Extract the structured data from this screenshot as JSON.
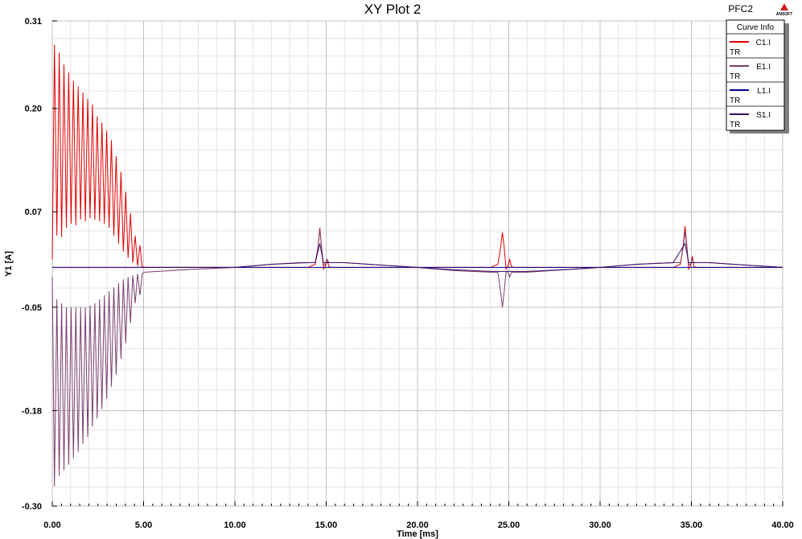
{
  "window": {
    "title": "XY Plot 2",
    "project": "PFC2",
    "logo_text": "ANSOFT"
  },
  "legend": {
    "title": "Curve Info",
    "entries": [
      {
        "name": "C1.I",
        "sub": "TR",
        "color": "#e00000"
      },
      {
        "name": "E1.I",
        "sub": "TR",
        "color": "#7a3e6e"
      },
      {
        "name": "L1.I",
        "sub": "TR",
        "color": "#000090"
      },
      {
        "name": "S1.I",
        "sub": "TR",
        "color": "#3a0a60"
      }
    ]
  },
  "chart_data": {
    "type": "line",
    "title": "XY Plot 2",
    "xlabel": "Time [ms]",
    "ylabel": "Y1 [A]",
    "xlim": [
      0,
      40
    ],
    "ylim": [
      -0.3,
      0.31
    ],
    "x_ticks": [
      "0.00",
      "5.00",
      "10.00",
      "15.00",
      "20.00",
      "25.00",
      "30.00",
      "35.00",
      "40.00"
    ],
    "y_ticks": [
      "0.31",
      "0.20",
      "0.07",
      "-0.05",
      "-0.18",
      "-0.30"
    ],
    "y_tick_values": [
      0.31,
      0.2,
      0.07,
      -0.05,
      -0.18,
      -0.3
    ],
    "grid": true,
    "legend_position": "top-right",
    "series": [
      {
        "name": "C1.I",
        "color": "#e00000",
        "points": [
          [
            0.0,
            0.01
          ],
          [
            0.12,
            0.28
          ],
          [
            0.25,
            0.04
          ],
          [
            0.38,
            0.27
          ],
          [
            0.51,
            0.038
          ],
          [
            0.64,
            0.255
          ],
          [
            0.77,
            0.05
          ],
          [
            0.9,
            0.245
          ],
          [
            1.03,
            0.055
          ],
          [
            1.16,
            0.235
          ],
          [
            1.29,
            0.053
          ],
          [
            1.42,
            0.228
          ],
          [
            1.55,
            0.06
          ],
          [
            1.68,
            0.22
          ],
          [
            1.81,
            0.058
          ],
          [
            1.94,
            0.212
          ],
          [
            2.07,
            0.062
          ],
          [
            2.2,
            0.205
          ],
          [
            2.33,
            0.06
          ],
          [
            2.46,
            0.19
          ],
          [
            2.59,
            0.058
          ],
          [
            2.72,
            0.182
          ],
          [
            2.85,
            0.055
          ],
          [
            2.98,
            0.172
          ],
          [
            3.11,
            0.05
          ],
          [
            3.24,
            0.16
          ],
          [
            3.37,
            0.04
          ],
          [
            3.5,
            0.14
          ],
          [
            3.63,
            0.03
          ],
          [
            3.76,
            0.12
          ],
          [
            3.89,
            0.02
          ],
          [
            4.02,
            0.095
          ],
          [
            4.15,
            0.012
          ],
          [
            4.28,
            0.068
          ],
          [
            4.41,
            0.006
          ],
          [
            4.54,
            0.04
          ],
          [
            4.67,
            0.002
          ],
          [
            4.8,
            0.028
          ],
          [
            4.92,
            0.001
          ],
          [
            5.05,
            0.0
          ],
          [
            6,
            0.0
          ],
          [
            8,
            0.0
          ],
          [
            10,
            0.0
          ],
          [
            12,
            0.0
          ],
          [
            14,
            0.0
          ],
          [
            14.4,
            0.004
          ],
          [
            14.55,
            0.025
          ],
          [
            14.65,
            0.05
          ],
          [
            14.75,
            0.025
          ],
          [
            14.85,
            -0.002
          ],
          [
            14.95,
            0.002
          ],
          [
            15.05,
            0.01
          ],
          [
            15.15,
            0.001
          ],
          [
            15.3,
            0.0
          ],
          [
            18,
            0.0
          ],
          [
            20,
            0.0
          ],
          [
            22,
            0.0
          ],
          [
            24,
            0.0
          ],
          [
            24.4,
            0.004
          ],
          [
            24.55,
            0.025
          ],
          [
            24.65,
            0.044
          ],
          [
            24.75,
            0.025
          ],
          [
            24.85,
            -0.002
          ],
          [
            24.95,
            0.002
          ],
          [
            25.05,
            0.01
          ],
          [
            25.15,
            0.001
          ],
          [
            25.3,
            0.0
          ],
          [
            28,
            0.0
          ],
          [
            30,
            0.0
          ],
          [
            32,
            0.0
          ],
          [
            34,
            0.0
          ],
          [
            34.4,
            0.004
          ],
          [
            34.55,
            0.028
          ],
          [
            34.65,
            0.052
          ],
          [
            34.75,
            0.028
          ],
          [
            34.85,
            -0.002
          ],
          [
            34.95,
            0.002
          ],
          [
            35.05,
            0.014
          ],
          [
            35.15,
            0.001
          ],
          [
            35.3,
            0.0
          ],
          [
            38,
            0.0
          ],
          [
            40,
            0.0
          ]
        ]
      },
      {
        "name": "E1.I",
        "color": "#7a3e6e",
        "points": [
          [
            0.0,
            -0.012
          ],
          [
            0.12,
            -0.275
          ],
          [
            0.25,
            -0.04
          ],
          [
            0.38,
            -0.262
          ],
          [
            0.51,
            -0.045
          ],
          [
            0.64,
            -0.255
          ],
          [
            0.77,
            -0.05
          ],
          [
            0.9,
            -0.248
          ],
          [
            1.03,
            -0.05
          ],
          [
            1.16,
            -0.24
          ],
          [
            1.29,
            -0.05
          ],
          [
            1.42,
            -0.232
          ],
          [
            1.55,
            -0.05
          ],
          [
            1.68,
            -0.222
          ],
          [
            1.81,
            -0.05
          ],
          [
            1.94,
            -0.213
          ],
          [
            2.07,
            -0.048
          ],
          [
            2.2,
            -0.2
          ],
          [
            2.33,
            -0.045
          ],
          [
            2.46,
            -0.19
          ],
          [
            2.59,
            -0.04
          ],
          [
            2.72,
            -0.178
          ],
          [
            2.85,
            -0.035
          ],
          [
            2.98,
            -0.165
          ],
          [
            3.11,
            -0.03
          ],
          [
            3.24,
            -0.15
          ],
          [
            3.37,
            -0.025
          ],
          [
            3.5,
            -0.135
          ],
          [
            3.63,
            -0.02
          ],
          [
            3.76,
            -0.115
          ],
          [
            3.89,
            -0.015
          ],
          [
            4.02,
            -0.095
          ],
          [
            4.15,
            -0.012
          ],
          [
            4.28,
            -0.07
          ],
          [
            4.41,
            -0.01
          ],
          [
            4.54,
            -0.045
          ],
          [
            4.67,
            -0.008
          ],
          [
            4.8,
            -0.035
          ],
          [
            4.92,
            -0.008
          ],
          [
            5.05,
            -0.006
          ],
          [
            6.5,
            -0.004
          ],
          [
            8,
            -0.002
          ],
          [
            10,
            0.0
          ],
          [
            12,
            0.004
          ],
          [
            13.5,
            0.006
          ],
          [
            14.4,
            0.006
          ],
          [
            14.55,
            0.025
          ],
          [
            14.65,
            0.048
          ],
          [
            14.75,
            0.025
          ],
          [
            14.85,
            0.003
          ],
          [
            14.95,
            0.004
          ],
          [
            15.05,
            0.01
          ],
          [
            15.15,
            0.006
          ],
          [
            16,
            0.006
          ],
          [
            18,
            0.003
          ],
          [
            20,
            0.0
          ],
          [
            22,
            -0.004
          ],
          [
            24,
            -0.006
          ],
          [
            24.4,
            -0.006
          ],
          [
            24.55,
            -0.03
          ],
          [
            24.65,
            -0.05
          ],
          [
            24.75,
            -0.03
          ],
          [
            24.85,
            -0.006
          ],
          [
            24.95,
            -0.005
          ],
          [
            25.05,
            -0.012
          ],
          [
            25.15,
            -0.006
          ],
          [
            26,
            -0.006
          ],
          [
            28,
            -0.003
          ],
          [
            30,
            0.0
          ],
          [
            32,
            0.004
          ],
          [
            34,
            0.006
          ],
          [
            34.4,
            0.006
          ],
          [
            34.55,
            0.025
          ],
          [
            34.65,
            0.046
          ],
          [
            34.75,
            0.025
          ],
          [
            34.85,
            0.003
          ],
          [
            34.95,
            0.004
          ],
          [
            35.05,
            0.01
          ],
          [
            35.15,
            0.006
          ],
          [
            36,
            0.006
          ],
          [
            38,
            0.003
          ],
          [
            40,
            0.0
          ]
        ]
      },
      {
        "name": "L1.I",
        "color": "#000090",
        "points": [
          [
            0,
            0.0
          ],
          [
            10,
            0.0
          ],
          [
            20,
            0.0
          ],
          [
            30,
            0.0
          ],
          [
            40,
            0.0
          ]
        ]
      },
      {
        "name": "S1.I",
        "color": "#3a0a60",
        "points": [
          [
            0,
            0.0
          ],
          [
            5,
            0.0
          ],
          [
            8,
            0.0
          ],
          [
            10,
            0.0
          ],
          [
            12,
            0.004
          ],
          [
            14,
            0.006
          ],
          [
            14.4,
            0.006
          ],
          [
            14.65,
            0.03
          ],
          [
            14.85,
            0.006
          ],
          [
            16,
            0.006
          ],
          [
            18,
            0.003
          ],
          [
            20,
            0.0
          ],
          [
            22,
            -0.003
          ],
          [
            24,
            -0.005
          ],
          [
            26,
            -0.005
          ],
          [
            28,
            -0.003
          ],
          [
            30,
            0.0
          ],
          [
            32,
            0.004
          ],
          [
            34,
            0.006
          ],
          [
            34.65,
            0.03
          ],
          [
            34.85,
            0.006
          ],
          [
            36,
            0.006
          ],
          [
            38,
            0.003
          ],
          [
            40,
            0.0
          ]
        ]
      }
    ]
  }
}
